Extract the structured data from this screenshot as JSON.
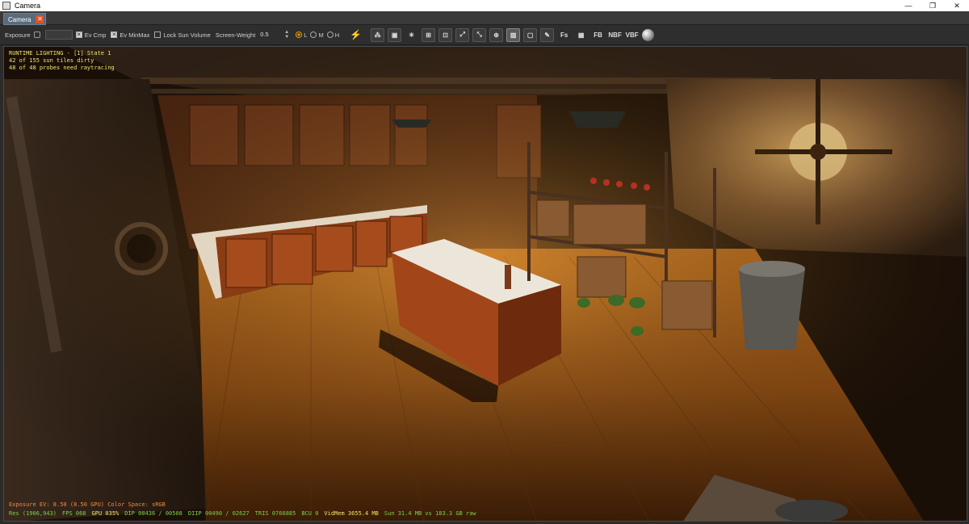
{
  "window": {
    "title": "Camera",
    "controls": {
      "minimize": "—",
      "restore": "❐",
      "close": "✕"
    }
  },
  "tabs": [
    {
      "label": "Camera",
      "close": "✕"
    }
  ],
  "toolbar": {
    "exposure_label": "Exposure",
    "ev_cmp_label": "Ev Cmp",
    "ev_minmax_label": "Ev MinMax",
    "lock_sun_volume_label": "Lock Sun Volume",
    "screen_weight_label": "Screen-Weight",
    "screen_weight_value": "0.5",
    "quality": {
      "low": "L",
      "medium": "M",
      "high": "H",
      "selected": "L"
    },
    "checkboxes": {
      "ev_cmp": true,
      "ev_minmax": true,
      "lock_sun_volume": false
    },
    "icon_text": {
      "fb": "FB",
      "nbf": "NBF",
      "vbf": "VBF",
      "fs": "Fs"
    }
  },
  "overlay": {
    "lighting_title": "RUNTIME LIGHTING - [1] State 1",
    "sun_tiles": "42 of 155 sun tiles dirty",
    "probes": "48 of 48 probes need raytracing",
    "exposure_line": "Exposure EV: 8.50 (8.50 GPU)  Color Space: sRGB",
    "stats": {
      "res": "Res (1906,943)",
      "fps": "FPS 068",
      "gpu": "GPU 035%",
      "dip": "DIP 00436 / 00508",
      "diip": "DIIP 00490 / 02627",
      "tris": "TRIS 0766885",
      "bcu": "BCU 0",
      "vidmem": "VidMem 3655.4 MB",
      "sun": "Sun 31.4 MB vs 183.3 GB raw"
    }
  },
  "colors": {
    "overlay_yellow": "#f2e46a",
    "overlay_orange": "#f08a40",
    "overlay_green": "#7ed04b",
    "tab_active": "#5a6b7c",
    "tab_close": "#d9532c"
  }
}
